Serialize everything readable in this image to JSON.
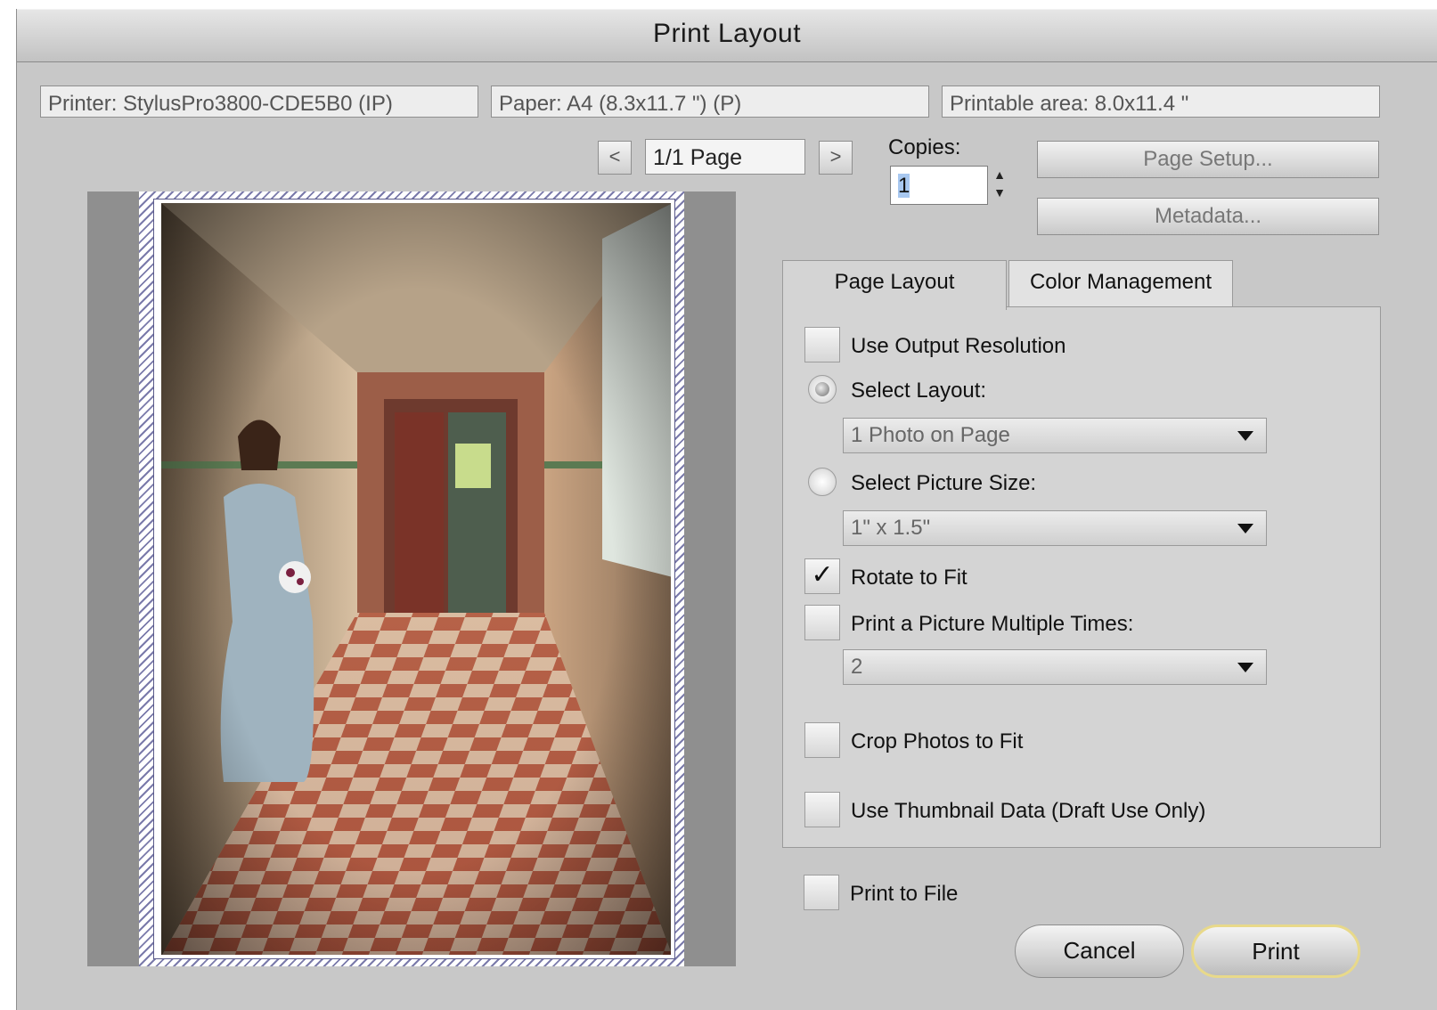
{
  "window": {
    "title": "Print Layout"
  },
  "info": {
    "printer": "Printer: StylusPro3800-CDE5B0 (IP)",
    "paper": "Paper: A4 (8.3x11.7 \") (P)",
    "printable_area": "Printable area: 8.0x11.4 \""
  },
  "pager": {
    "prev_label": "<",
    "page": "1/1 Page",
    "next_label": ">"
  },
  "copies": {
    "label": "Copies:",
    "value": "1",
    "up": "▲",
    "down": "▼"
  },
  "buttons": {
    "page_setup": "Page Setup...",
    "metadata": "Metadata...",
    "cancel": "Cancel",
    "print": "Print"
  },
  "tabs": [
    {
      "label": "Page Layout",
      "active": true
    },
    {
      "label": "Color Management",
      "active": false
    }
  ],
  "options": {
    "use_output_resolution": {
      "label": "Use Output Resolution",
      "checked": false
    },
    "select_layout": {
      "label": "Select Layout:",
      "selected": true,
      "value": "1 Photo on Page"
    },
    "select_picture_size": {
      "label": "Select Picture Size:",
      "selected": false,
      "value": "1\" x 1.5\""
    },
    "rotate_to_fit": {
      "label": "Rotate to Fit",
      "checked": true,
      "mark": "✓"
    },
    "print_multiple": {
      "label": "Print a Picture Multiple Times:",
      "checked": false,
      "value": "2"
    },
    "crop_to_fit": {
      "label": "Crop Photos to Fit",
      "checked": false
    },
    "use_thumbnail": {
      "label": "Use Thumbnail Data (Draft Use Only)",
      "checked": false
    },
    "print_to_file": {
      "label": "Print to File",
      "checked": false
    }
  },
  "colors": {
    "default_button_border": "#e8d98a",
    "selection": "#a8c8f0"
  }
}
